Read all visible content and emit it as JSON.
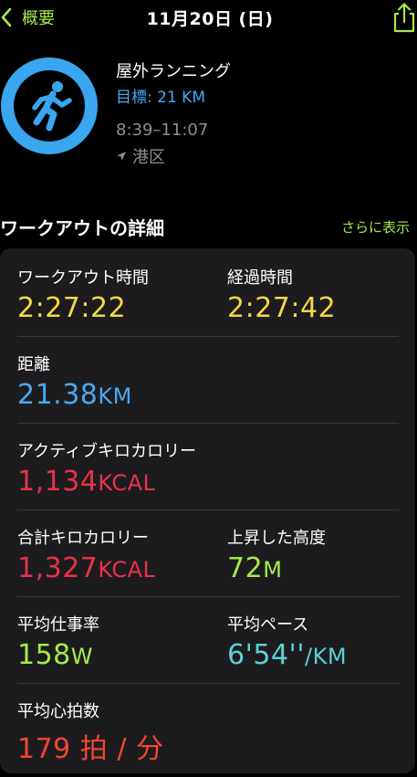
{
  "nav": {
    "back_label": "概要",
    "title": "11月20日 (日)"
  },
  "workout": {
    "name": "屋外ランニング",
    "goal": "目標: 21 KM",
    "time_range": "8:39–11:07",
    "location": "港区",
    "ring_progress": 1.0,
    "ring_color": "#3aa6f0"
  },
  "details": {
    "title": "ワークアウトの詳細",
    "more": "さらに表示",
    "workout_time": {
      "label": "ワークアウト時間",
      "value": "2:27:22"
    },
    "elapsed_time": {
      "label": "経過時間",
      "value": "2:27:42"
    },
    "distance": {
      "label": "距離",
      "value": "21.38",
      "unit": "KM"
    },
    "active_calories": {
      "label": "アクティブキロカロリー",
      "value": "1,134",
      "unit": "KCAL"
    },
    "total_calories": {
      "label": "合計キロカロリー",
      "value": "1,327",
      "unit": "KCAL"
    },
    "elevation_gain": {
      "label": "上昇した高度",
      "value": "72",
      "unit": "M"
    },
    "avg_power": {
      "label": "平均仕事率",
      "value": "158",
      "unit": "W"
    },
    "avg_pace": {
      "label": "平均ペース",
      "value": "6'54''",
      "unit": "/KM"
    },
    "avg_heart_rate": {
      "label": "平均心拍数",
      "value": "179 拍 / 分"
    }
  },
  "colors": {
    "accent": "#a6e94b",
    "yellow": "#f6d742",
    "blue": "#4aa8ef",
    "red": "#e8304a",
    "green": "#a4eb4a",
    "cyan": "#5ed0d2",
    "orange": "#f2452f"
  }
}
